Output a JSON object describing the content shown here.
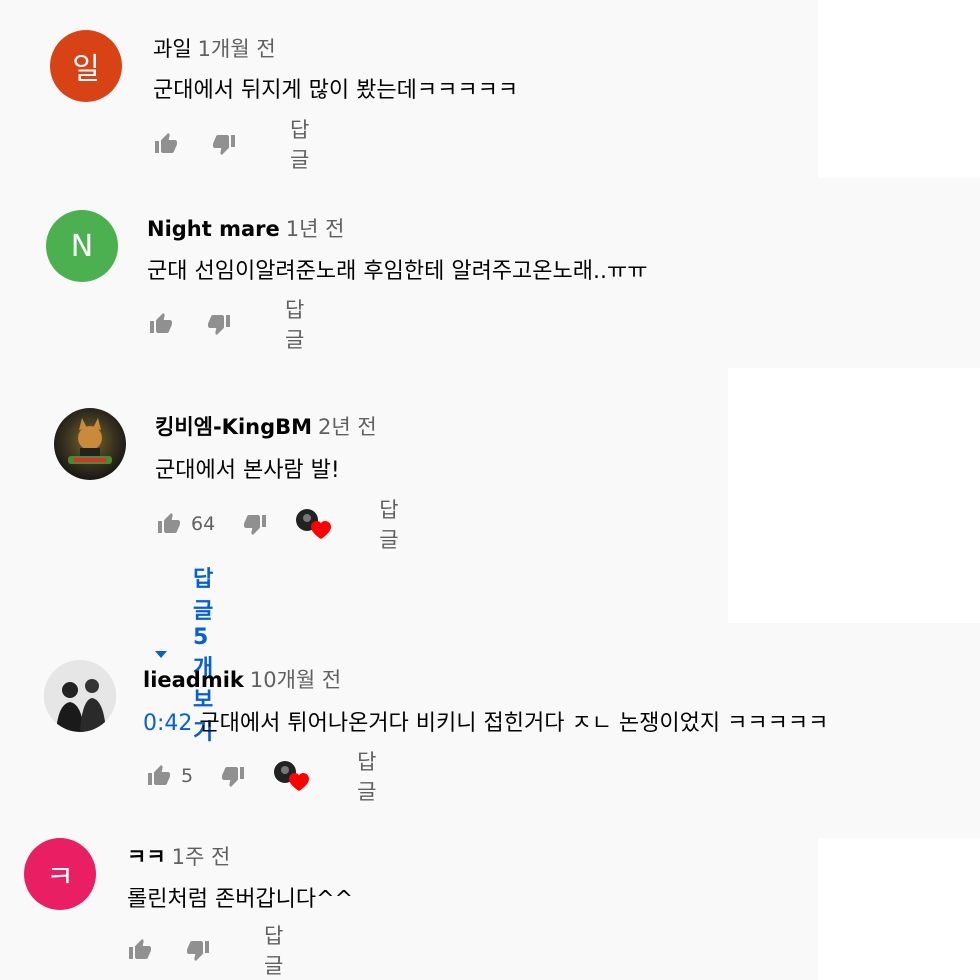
{
  "comments": [
    {
      "author": "과일",
      "time": "1개월 전",
      "text": "군대에서 뒤지게 많이 봤는데ㅋㅋㅋㅋㅋ",
      "avatar_letter": "일",
      "avatar_color": "#d84315",
      "reply_label": "답글"
    },
    {
      "author": "Night mare",
      "time": "1년 전",
      "text": "군대 선임이알려준노래 후임한테 알려주고온노래..ㅠㅠ",
      "avatar_letter": "N",
      "avatar_color": "#4caf50",
      "reply_label": "답글"
    },
    {
      "author": "킹비엠-KingBM",
      "time": "2년 전",
      "text": "군대에서 본사람 발!",
      "like_count": "64",
      "reply_label": "답글",
      "view_replies": "답글 5개 보기"
    },
    {
      "author": "lieadmik",
      "time": "10개월 전",
      "timestamp_link": "0:42",
      "text": "군대에서 튀어나온거다 비키니 접힌거다 ㅈㄴ 논쟁이었지 ㅋㅋㅋㅋㅋ",
      "like_count": "5",
      "reply_label": "답글"
    },
    {
      "author": "ㅋㅋ",
      "time": "1주 전",
      "text": "롤린처럼 존버갑니다^^",
      "avatar_letter": "ㅋ",
      "avatar_color": "#e91e63",
      "reply_label": "답글"
    }
  ],
  "colors": {
    "background": "#f9f9f9",
    "link_blue": "#065fd4",
    "secondary_text": "#606060",
    "heart_red": "#ff0000"
  },
  "icons": [
    "thumb-up-icon",
    "thumb-down-icon",
    "creator-heart-icon",
    "caret-down-icon"
  ]
}
